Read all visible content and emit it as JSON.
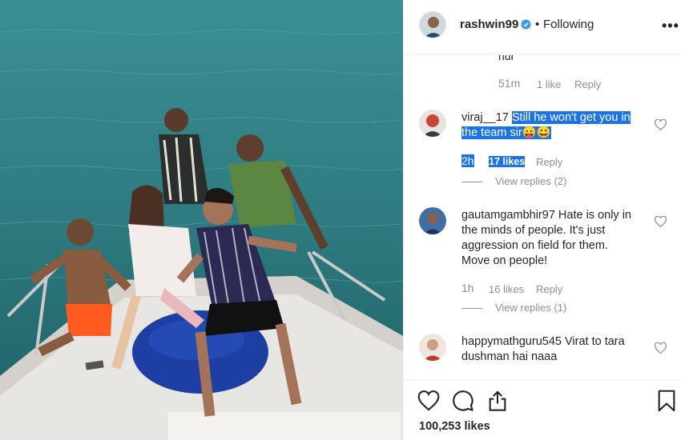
{
  "post": {
    "username": "rashwin99",
    "separator": "•",
    "follow_status": "Following",
    "more_label": "•••",
    "likes_text": "100,253 likes"
  },
  "comments": {
    "cut_off_text": "nur",
    "prev_meta": {
      "time": "51m",
      "likes": "1 like",
      "reply": "Reply"
    },
    "items": [
      {
        "user": "viraj__17",
        "text_highlighted_1": "Still he won't get you in",
        "text_highlighted_2": "the team sir",
        "emoji": "😛😀",
        "time": "2h",
        "likes": "17 likes",
        "reply": "Reply",
        "view_replies": "View replies (2)"
      },
      {
        "user": "gautamgambhir97",
        "text_line1": "Hate is only in",
        "text_line2": "the minds of people. It's just",
        "text_line3": "aggression on field for them.",
        "text_line4": "Move on people!",
        "time": "1h",
        "likes": "16 likes",
        "reply": "Reply",
        "view_replies": "View replies (1)"
      },
      {
        "user": "happymathguru545",
        "text_line1": "Virat to tara",
        "text_line2": "dushman hai naaa"
      }
    ]
  },
  "colors": {
    "verified": "#3897f0",
    "highlight": "#1a73e8",
    "secondary_text": "#8e8e8e",
    "sea": "#2f7a7f"
  },
  "icons": [
    "verified-badge-icon",
    "heart-icon",
    "comment-icon",
    "share-icon",
    "bookmark-icon",
    "more-icon"
  ]
}
